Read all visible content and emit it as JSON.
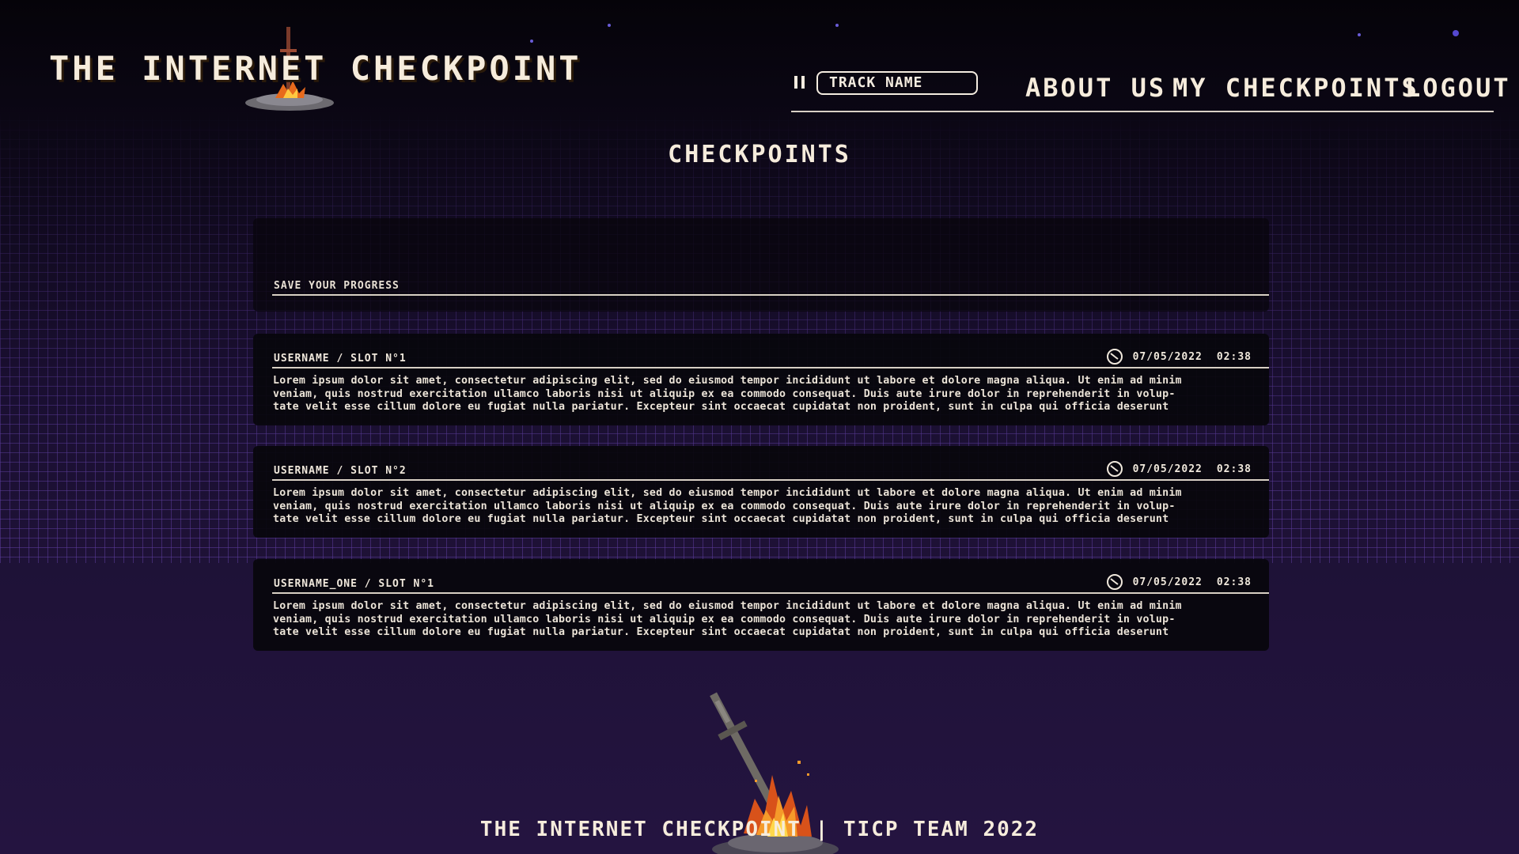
{
  "brand": {
    "logo_text": "THE INTERNET CHECKPOINT"
  },
  "player": {
    "track_name": "TRACK NAME",
    "pause_icon": "pause-icon"
  },
  "nav": {
    "about": "ABOUT US",
    "my_checkpoints": "MY CHECKPOINTS",
    "logout": "LOGOUT"
  },
  "page": {
    "title": "CHECKPOINTS"
  },
  "save_form": {
    "placeholder": "SAVE YOUR PROGRESS"
  },
  "checkpoints": [
    {
      "user_slot": "USERNAME / SLOT N°1",
      "date": "07/05/2022",
      "time": "02:38",
      "icon": "clock-icon",
      "text": "Lorem ipsum dolor sit amet, consectetur adipiscing elit, sed do eiusmod tempor incididunt ut labore et dolore magna aliqua. Ut enim ad minim\nveniam, quis nostrud exercitation ullamco laboris nisi ut aliquip ex ea commodo consequat. Duis aute irure dolor in reprehenderit in volup-\ntate velit esse cillum dolore eu fugiat nulla pariatur. Excepteur sint occaecat cupidatat non proident, sunt in culpa qui officia deserunt"
    },
    {
      "user_slot": "USERNAME / SLOT N°2",
      "date": "07/05/2022",
      "time": "02:38",
      "icon": "clock-icon",
      "text": "Lorem ipsum dolor sit amet, consectetur adipiscing elit, sed do eiusmod tempor incididunt ut labore et dolore magna aliqua. Ut enim ad minim\nveniam, quis nostrud exercitation ullamco laboris nisi ut aliquip ex ea commodo consequat. Duis aute irure dolor in reprehenderit in volup-\ntate velit esse cillum dolore eu fugiat nulla pariatur. Excepteur sint occaecat cupidatat non proident, sunt in culpa qui officia deserunt"
    },
    {
      "user_slot": "USERNAME_ONE / SLOT N°1",
      "date": "07/05/2022",
      "time": "02:38",
      "icon": "clock-icon",
      "text": "Lorem ipsum dolor sit amet, consectetur adipiscing elit, sed do eiusmod tempor incididunt ut labore et dolore magna aliqua. Ut enim ad minim\nveniam, quis nostrud exercitation ullamco laboris nisi ut aliquip ex ea commodo consequat. Duis aute irure dolor in reprehenderit in volup-\ntate velit esse cillum dolore eu fugiat nulla pariatur. Excepteur sint occaecat cupidatat non proident, sunt in culpa qui officia deserunt"
    }
  ],
  "footer": {
    "text": "THE INTERNET CHECKPOINT | TICP TEAM 2022"
  },
  "colors": {
    "text": "#f4ece0",
    "card": "#08060c",
    "grid": "#7850c8",
    "background_bottom": "#241440"
  }
}
